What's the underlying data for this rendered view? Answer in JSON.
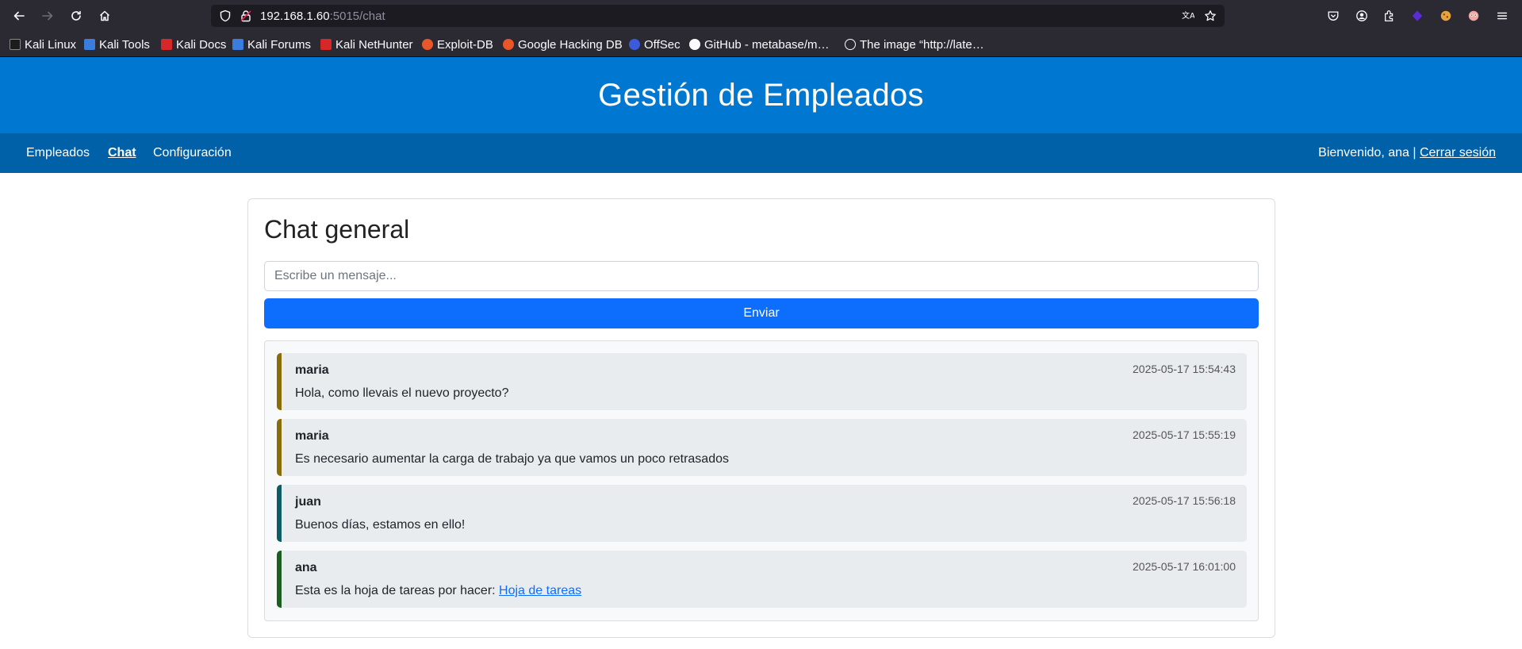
{
  "browser": {
    "url_host": "192.168.1.60",
    "url_path": ":5015/chat",
    "bookmarks": [
      {
        "label": "Kali Linux",
        "icon": "kali-dragon-icon",
        "color": "#1c1c1c"
      },
      {
        "label": "Kali Tools",
        "icon": "kali-tools-icon",
        "color": "#3b7ddd"
      },
      {
        "label": "Kali Docs",
        "icon": "kali-docs-icon",
        "color": "#d62828"
      },
      {
        "label": "Kali Forums",
        "icon": "kali-forums-icon",
        "color": "#3b7ddd"
      },
      {
        "label": "Kali NetHunter",
        "icon": "nethunter-icon",
        "color": "#d62828"
      },
      {
        "label": "Exploit-DB",
        "icon": "exploit-db-icon",
        "color": "#e8562a"
      },
      {
        "label": "Google Hacking DB",
        "icon": "ghdb-icon",
        "color": "#e8562a"
      },
      {
        "label": "OffSec",
        "icon": "offsec-icon",
        "color": "#3b5bdb"
      },
      {
        "label": "GitHub - metabase/m…",
        "icon": "github-icon",
        "color": "#ffffff"
      },
      {
        "label": "The image “http://late…",
        "icon": "globe-icon",
        "color": "#ffffff"
      }
    ]
  },
  "app": {
    "title": "Gestión de Empleados",
    "nav": {
      "items": [
        {
          "label": "Empleados",
          "active": false
        },
        {
          "label": "Chat",
          "active": true
        },
        {
          "label": "Configuración",
          "active": false
        }
      ],
      "welcome": "Bienvenido, ana | ",
      "logout": "Cerrar sesión"
    },
    "colors": {
      "header": "#0077d0",
      "nav": "#0061a8",
      "send_button": "#0d6efd"
    }
  },
  "chat": {
    "title": "Chat general",
    "input_placeholder": "Escribe un mensaje...",
    "send_label": "Enviar",
    "messages": [
      {
        "author": "maria",
        "time": "2025-05-17 15:54:43",
        "text": "Hola, como llevais el nuevo proyecto?",
        "accent": "#8a6d0b"
      },
      {
        "author": "maria",
        "time": "2025-05-17 15:55:19",
        "text": "Es necesario aumentar la carga de trabajo ya que vamos un poco retrasados",
        "accent": "#8a6d0b"
      },
      {
        "author": "juan",
        "time": "2025-05-17 15:56:18",
        "text": "Buenos días, estamos en ello!",
        "accent": "#0d5c63"
      },
      {
        "author": "ana",
        "time": "2025-05-17 16:01:00",
        "text": "Esta es la hoja de tareas por hacer: ",
        "link": "Hoja de tareas",
        "accent": "#1b5e20"
      }
    ]
  }
}
